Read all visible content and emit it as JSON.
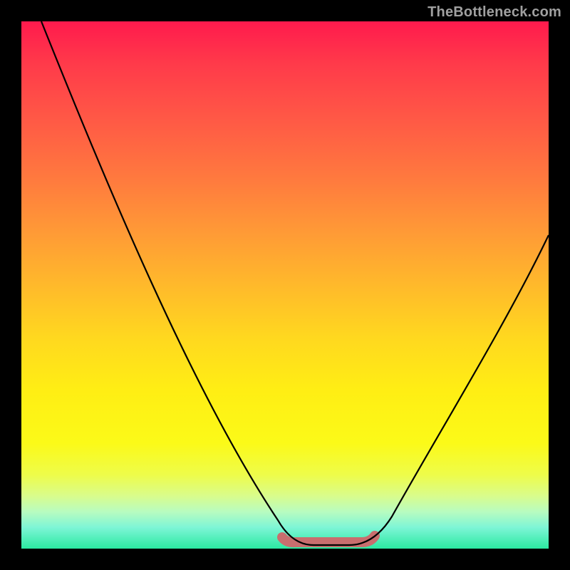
{
  "branding": {
    "text": "TheBottleneck.com"
  },
  "colors": {
    "background_black": "#000000",
    "branding_text": "#a0a0a0",
    "curve": "#000000",
    "sweet_spot_band": "#c86e6e"
  },
  "chart_data": {
    "type": "line",
    "title": "",
    "xlabel": "",
    "ylabel": "",
    "x": [
      0.0,
      0.05,
      0.1,
      0.15,
      0.2,
      0.25,
      0.3,
      0.35,
      0.4,
      0.45,
      0.5,
      0.55,
      0.6,
      0.65,
      0.7,
      0.75,
      0.8,
      0.85,
      0.9,
      0.95,
      1.0
    ],
    "xlim": [
      0,
      1
    ],
    "ylim": [
      0,
      1
    ],
    "grid": false,
    "legend": false,
    "series": [
      {
        "name": "bottleneck-curve",
        "values": [
          1.0,
          0.89,
          0.79,
          0.69,
          0.59,
          0.5,
          0.41,
          0.32,
          0.23,
          0.14,
          0.06,
          0.01,
          0.0,
          0.0,
          0.03,
          0.12,
          0.22,
          0.32,
          0.42,
          0.51,
          0.6
        ]
      }
    ],
    "annotations": [
      {
        "name": "sweet-spot-band",
        "x_range": [
          0.49,
          0.67
        ],
        "y": 0.01
      }
    ]
  }
}
